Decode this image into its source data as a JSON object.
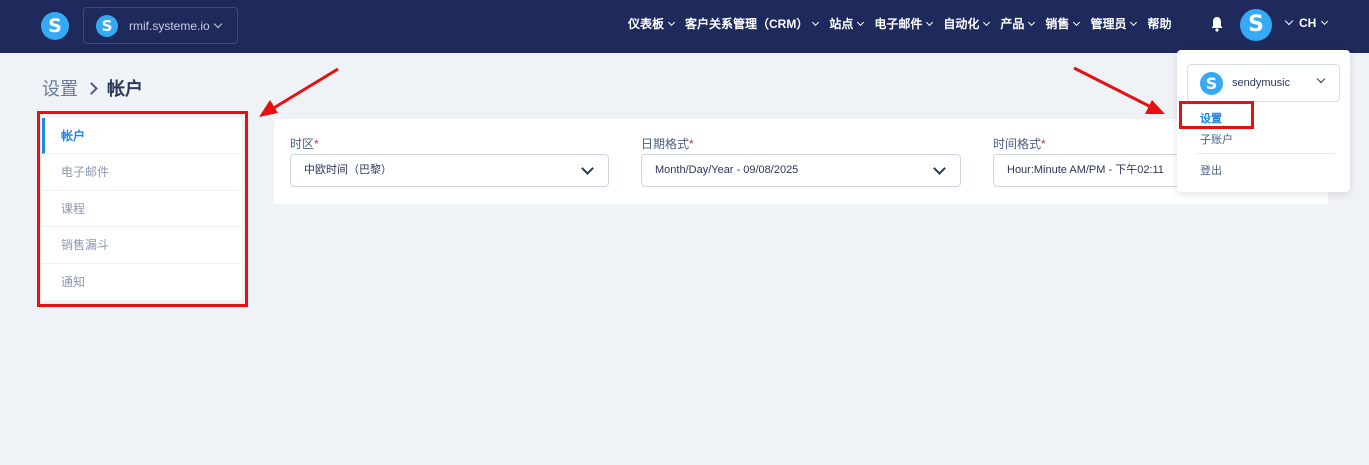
{
  "topbar": {
    "brand_logo_letter": "S",
    "site_selector": {
      "logo_letter": "S",
      "name": "rmif.systeme.io"
    },
    "nav_items": [
      {
        "label": "仪表板",
        "has_dropdown": true
      },
      {
        "label": "客户关系管理（CRM）",
        "has_dropdown": true
      },
      {
        "label": "站点",
        "has_dropdown": true
      },
      {
        "label": "电子邮件",
        "has_dropdown": true
      },
      {
        "label": "自动化",
        "has_dropdown": true
      },
      {
        "label": "产品",
        "has_dropdown": true
      },
      {
        "label": "销售",
        "has_dropdown": true
      },
      {
        "label": "管理员",
        "has_dropdown": true
      },
      {
        "label": "帮助",
        "has_dropdown": false
      }
    ],
    "notification_icon": "bell-icon",
    "user_logo_letter": "S",
    "language": "CH"
  },
  "breadcrumb": {
    "parent": "设置",
    "current": "帐户"
  },
  "side_menu": {
    "items": [
      {
        "label": "帐户",
        "active": true
      },
      {
        "label": "电子邮件",
        "active": false
      },
      {
        "label": "课程",
        "active": false
      },
      {
        "label": "销售漏斗",
        "active": false
      },
      {
        "label": "通知",
        "active": false
      }
    ]
  },
  "form": {
    "timezone": {
      "label": "时区",
      "required_mark": "*",
      "value": "中欧时间（巴黎）"
    },
    "date_format": {
      "label": "日期格式",
      "required_mark": "*",
      "value": "Month/Day/Year - 09/08/2025"
    },
    "time_format": {
      "label": "时间格式",
      "required_mark": "*",
      "value": "Hour:Minute AM/PM - 下午02:11"
    }
  },
  "user_dropdown": {
    "account": {
      "logo_letter": "S",
      "name": "sendymusic"
    },
    "items": [
      {
        "label": "设置",
        "active": true
      },
      {
        "label": "子账户",
        "active": false
      },
      {
        "label": "登出",
        "active": false
      }
    ]
  },
  "colors": {
    "topbar_bg": "#1f2a5c",
    "accent": "#1e86e5",
    "logo": "#36a9f5",
    "annotation_red": "#e61010",
    "required": "#e0245e"
  }
}
